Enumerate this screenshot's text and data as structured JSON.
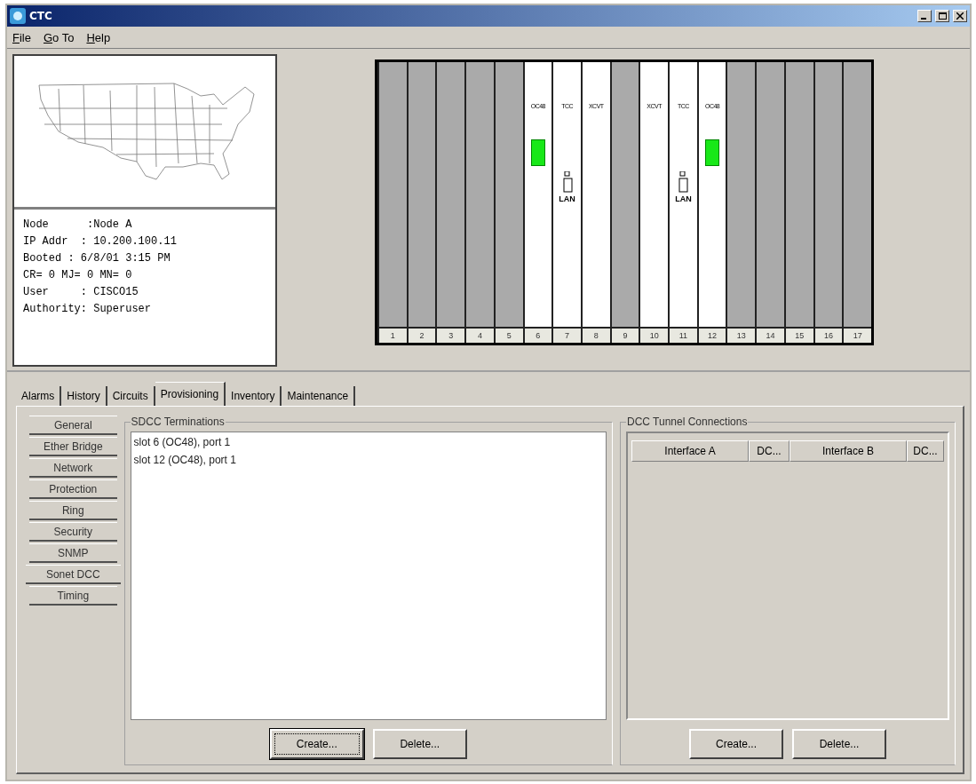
{
  "window": {
    "title": "CTC"
  },
  "menu": [
    "File",
    "Go To",
    "Help"
  ],
  "node_info": [
    "Node      :Node A",
    "IP Addr  : 10.200.100.11",
    "Booted : 6/8/01 3:15 PM",
    "CR= 0 MJ= 0 MN= 0",
    "User     : CISCO15",
    "Authority: Superuser"
  ],
  "shelf": {
    "slots": [
      {
        "number": "1",
        "kind": "empty"
      },
      {
        "number": "2",
        "kind": "empty"
      },
      {
        "number": "3",
        "kind": "empty"
      },
      {
        "number": "4",
        "kind": "empty"
      },
      {
        "number": "5",
        "kind": "empty"
      },
      {
        "number": "6",
        "kind": "optical",
        "label": "OC48"
      },
      {
        "number": "7",
        "kind": "control",
        "label": "TCC",
        "port_label": "LAN"
      },
      {
        "number": "8",
        "kind": "cross",
        "label": "XCVT"
      },
      {
        "number": "9",
        "kind": "empty"
      },
      {
        "number": "10",
        "kind": "cross",
        "label": "XCVT"
      },
      {
        "number": "11",
        "kind": "control",
        "label": "TCC",
        "port_label": "LAN"
      },
      {
        "number": "12",
        "kind": "optical",
        "label": "OC48"
      },
      {
        "number": "13",
        "kind": "empty"
      },
      {
        "number": "14",
        "kind": "empty"
      },
      {
        "number": "15",
        "kind": "empty"
      },
      {
        "number": "16",
        "kind": "empty"
      },
      {
        "number": "17",
        "kind": "empty"
      }
    ]
  },
  "tabs": [
    {
      "label": "Alarms",
      "selected": false
    },
    {
      "label": "History",
      "selected": false
    },
    {
      "label": "Circuits",
      "selected": false
    },
    {
      "label": "Provisioning",
      "selected": true
    },
    {
      "label": "Inventory",
      "selected": false
    },
    {
      "label": "Maintenance",
      "selected": false
    }
  ],
  "subtabs": [
    {
      "label": "General",
      "selected": false
    },
    {
      "label": "Ether Bridge",
      "selected": false
    },
    {
      "label": "Network",
      "selected": false
    },
    {
      "label": "Protection",
      "selected": false
    },
    {
      "label": "Ring",
      "selected": false
    },
    {
      "label": "Security",
      "selected": false
    },
    {
      "label": "SNMP",
      "selected": false
    },
    {
      "label": "Sonet DCC",
      "selected": true
    },
    {
      "label": "Timing",
      "selected": false
    }
  ],
  "sdcc": {
    "title": "SDCC Terminations",
    "items": [
      "slot 6 (OC48), port 1",
      "slot 12 (OC48), port 1"
    ],
    "buttons": [
      {
        "label": "Create...",
        "focused": true
      },
      {
        "label": "Delete...",
        "focused": false
      }
    ]
  },
  "dcc_tunnels": {
    "title": "DCC Tunnel Connections",
    "columns": [
      "Interface A",
      "DC...",
      "Interface B",
      "DC..."
    ],
    "buttons": [
      {
        "label": "Create...",
        "focused": false
      },
      {
        "label": "Delete...",
        "focused": false
      }
    ]
  }
}
